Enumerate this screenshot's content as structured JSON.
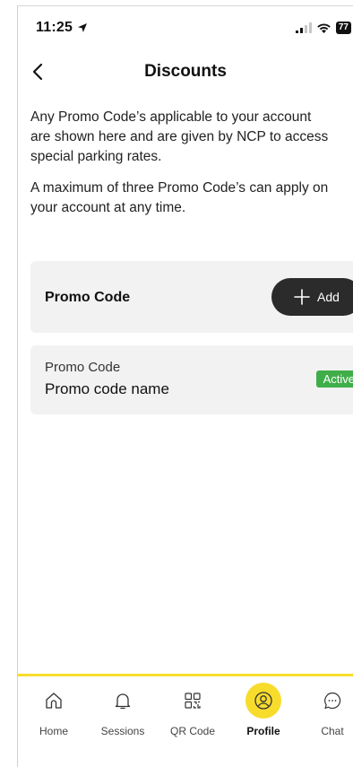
{
  "status_bar": {
    "time": "11:25",
    "battery": "77"
  },
  "header": {
    "title": "Discounts"
  },
  "intro": {
    "line1a": "Any Promo Code’s applicable to your account",
    "line1b": "are shown here and are given by NCP to access",
    "line1c": "special parking rates.",
    "line2a": "A maximum of three Promo Code’s can apply on",
    "line2b": "your account at any time."
  },
  "promo_add": {
    "label": "Promo Code",
    "button_label": "Add"
  },
  "promo_item": {
    "subtitle": "Promo Code",
    "name": "Promo code name",
    "status": "Active"
  },
  "nav": {
    "items": [
      {
        "label": "Home",
        "icon": "home-icon"
      },
      {
        "label": "Sessions",
        "icon": "bell-icon"
      },
      {
        "label": "QR Code",
        "icon": "qr-code-icon"
      },
      {
        "label": "Profile",
        "icon": "profile-icon",
        "active": true
      },
      {
        "label": "Chat",
        "icon": "chat-icon"
      }
    ]
  },
  "colors": {
    "accent": "#f7dc2c",
    "active_badge": "#3fae49",
    "button_dark": "#2b2b2b",
    "card_bg": "#f2f2f2"
  }
}
